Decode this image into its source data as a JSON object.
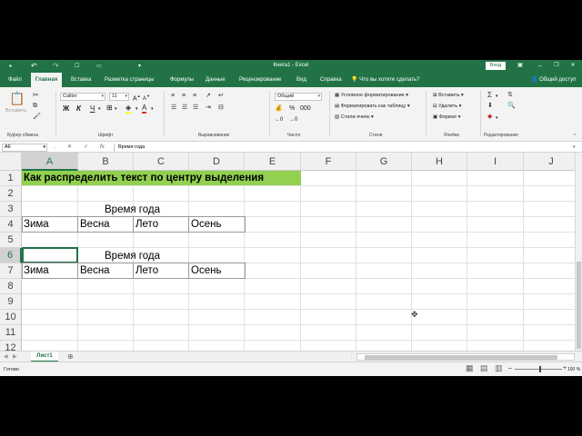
{
  "window": {
    "title": "Книга1  -  Excel",
    "signin": "Вход",
    "min_icon": "–",
    "restore_icon": "❐",
    "close_icon": "✕"
  },
  "qat": {
    "save": "▪",
    "undo": "↶",
    "redo": "↷",
    "customize": "▾"
  },
  "tabs": [
    "Файл",
    "Главная",
    "Вставка",
    "Разметка страницы",
    "Формулы",
    "Данные",
    "Рецензирование",
    "Вид",
    "Справка"
  ],
  "active_tab": "Главная",
  "tell_me": "Что вы хотите сделать?",
  "share": "Общий доступ",
  "ribbon": {
    "clipboard": {
      "label": "Буфер обмена",
      "paste": "Вставить"
    },
    "font": {
      "label": "Шрифт",
      "name": "Calibri",
      "size": "11",
      "bold": "Ж",
      "italic": "К",
      "underline": "Ч"
    },
    "alignment": {
      "label": "Выравнивание"
    },
    "number": {
      "label": "Число",
      "format": "Общий"
    },
    "styles": {
      "label": "Стили",
      "conditional": "Условное форматирование",
      "as_table": "Форматировать как таблицу",
      "cell_styles": "Стили ячеек"
    },
    "cells": {
      "label": "Ячейки",
      "insert": "Вставить",
      "delete": "Удалить",
      "format": "Формат"
    },
    "editing": {
      "label": "Редактирование"
    }
  },
  "formula_bar": {
    "name_box": "A6",
    "cancel": "✕",
    "enter": "✓",
    "fx": "fx",
    "content": "Время года"
  },
  "columns": [
    "A",
    "B",
    "C",
    "D",
    "E",
    "F",
    "G",
    "H",
    "I",
    "J"
  ],
  "rows": [
    "1",
    "2",
    "3",
    "4",
    "5",
    "6",
    "7",
    "8",
    "9",
    "10",
    "11",
    "12"
  ],
  "cells": {
    "a1": "Как распределить текст по центру выделения",
    "b3": "Время года",
    "a4": "Зима",
    "b4": "Весна",
    "c4": "Лето",
    "d4": "Осень",
    "b6": "Время года",
    "a7": "Зима",
    "b7": "Весна",
    "c7": "Лето",
    "d7": "Осень"
  },
  "sheet": {
    "name": "Лист1",
    "add": "⊕"
  },
  "status": {
    "ready": "Готово",
    "zoom": "100 %"
  },
  "colors": {
    "accent": "#217346",
    "highlight": "#92d050"
  }
}
